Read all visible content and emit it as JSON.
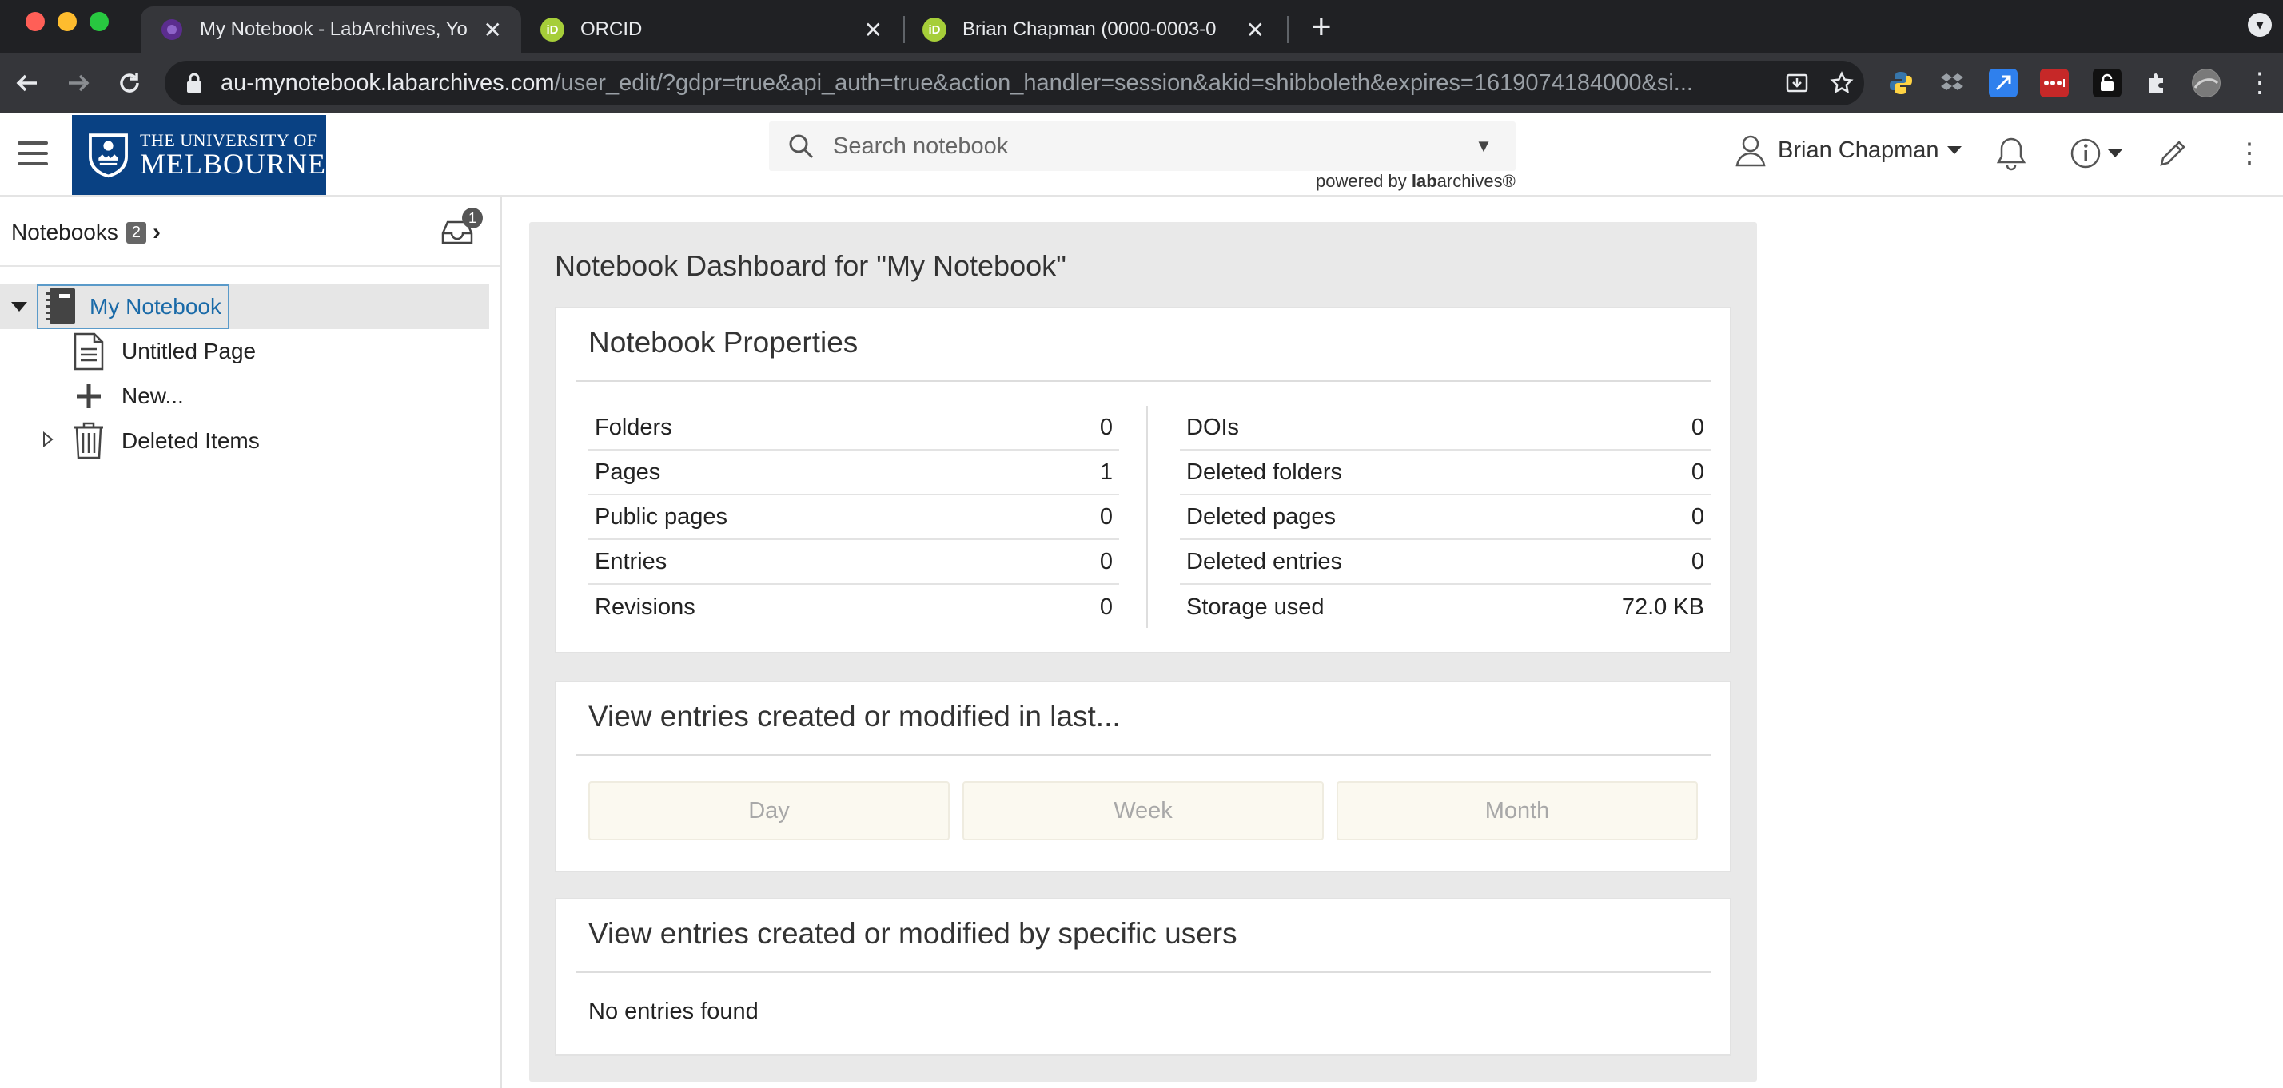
{
  "browser": {
    "tabs": [
      {
        "title": "My Notebook - LabArchives, Yo",
        "active": true,
        "favicon_color": "#6b3fa0"
      },
      {
        "title": "ORCID",
        "active": false,
        "favicon_color": "#a6ce39",
        "favicon_text": "iD"
      },
      {
        "title": "Brian Chapman (0000-0003-0",
        "active": false,
        "favicon_color": "#a6ce39",
        "favicon_text": "iD"
      }
    ],
    "url_host": "au-mynotebook.labarchives.com",
    "url_path": "/user_edit/?gdpr=true&api_auth=true&action_handler=session&akid=shibboleth&expires=1619074184000&si..."
  },
  "header": {
    "logo_line1": "THE UNIVERSITY OF",
    "logo_line2": "MELBOURNE",
    "search_placeholder": "Search notebook",
    "powered_prefix": "powered by ",
    "powered_lab": "lab",
    "powered_suffix": "archives®",
    "user_name": "Brian Chapman"
  },
  "sidebar": {
    "notebooks_label": "Notebooks",
    "notebooks_count": "2",
    "inbox_count": "1",
    "tree": {
      "notebook": "My Notebook",
      "page": "Untitled Page",
      "new": "New...",
      "deleted": "Deleted Items"
    }
  },
  "dashboard": {
    "title": "Notebook Dashboard for \"My Notebook\"",
    "properties": {
      "title": "Notebook Properties",
      "left": [
        {
          "label": "Folders",
          "value": "0"
        },
        {
          "label": "Pages",
          "value": "1"
        },
        {
          "label": "Public pages",
          "value": "0"
        },
        {
          "label": "Entries",
          "value": "0"
        },
        {
          "label": "Revisions",
          "value": "0"
        }
      ],
      "right": [
        {
          "label": "DOIs",
          "value": "0"
        },
        {
          "label": "Deleted folders",
          "value": "0"
        },
        {
          "label": "Deleted pages",
          "value": "0"
        },
        {
          "label": "Deleted entries",
          "value": "0"
        },
        {
          "label": "Storage used",
          "value": "72.0 KB"
        }
      ]
    },
    "recent": {
      "title": "View entries created or modified in last...",
      "buttons": [
        "Day",
        "Week",
        "Month"
      ]
    },
    "by_user": {
      "title": "View entries created or modified by specific users",
      "empty": "No entries found"
    }
  },
  "colors": {
    "brand_navy": "#094183",
    "link_blue": "#1a6aa8"
  }
}
